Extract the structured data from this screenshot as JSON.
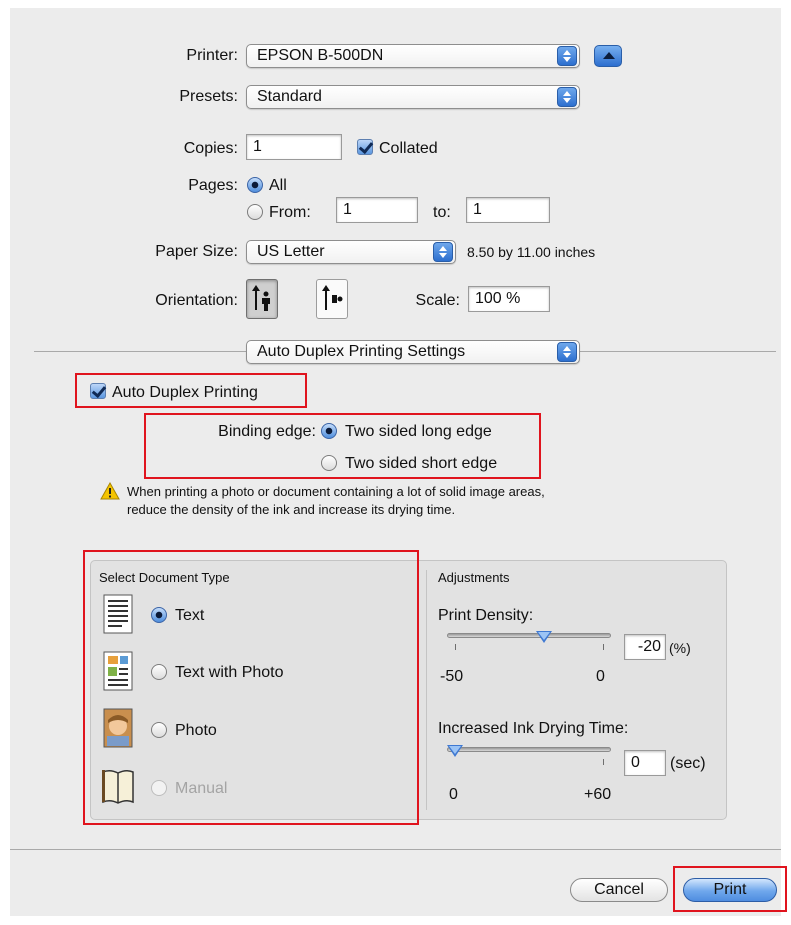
{
  "printer": {
    "label": "Printer:",
    "value": "EPSON B-500DN"
  },
  "presets": {
    "label": "Presets:",
    "value": "Standard"
  },
  "copies": {
    "label": "Copies:",
    "value": "1",
    "collated_label": "Collated",
    "collated_checked": true
  },
  "pages": {
    "label": "Pages:",
    "all_label": "All",
    "from_label": "From:",
    "from_value": "1",
    "to_label": "to:",
    "to_value": "1"
  },
  "paper_size": {
    "label": "Paper Size:",
    "value": "US Letter",
    "dims": "8.50 by 11.00 inches"
  },
  "orientation": {
    "label": "Orientation:"
  },
  "scale": {
    "label": "Scale:",
    "value": "100 %"
  },
  "panel_menu": {
    "value": "Auto Duplex Printing Settings"
  },
  "duplex": {
    "checkbox_label": "Auto Duplex Printing",
    "binding_label": "Binding edge:",
    "long_edge": "Two sided long edge",
    "short_edge": "Two sided short edge",
    "warning_line1": "When printing a photo or document containing a lot of solid image areas,",
    "warning_line2": "reduce the density of the ink and increase its drying time."
  },
  "doc_type": {
    "title": "Select Document Type",
    "options": [
      "Text",
      "Text with Photo",
      "Photo",
      "Manual"
    ],
    "selected": "Text"
  },
  "adjustments": {
    "title": "Adjustments",
    "density_label": "Print Density:",
    "density_value": "-20",
    "density_unit": "(%)",
    "density_min": "-50",
    "density_max": "0",
    "density_level": -20,
    "drying_label": "Increased Ink Drying Time:",
    "drying_value": "0",
    "drying_unit": "(sec)",
    "drying_min": "0",
    "drying_max": "+60",
    "drying_level": 0
  },
  "buttons": {
    "cancel": "Cancel",
    "print": "Print"
  },
  "colors": {
    "highlight": "#e0141e",
    "accent": "#2d6fcf"
  }
}
